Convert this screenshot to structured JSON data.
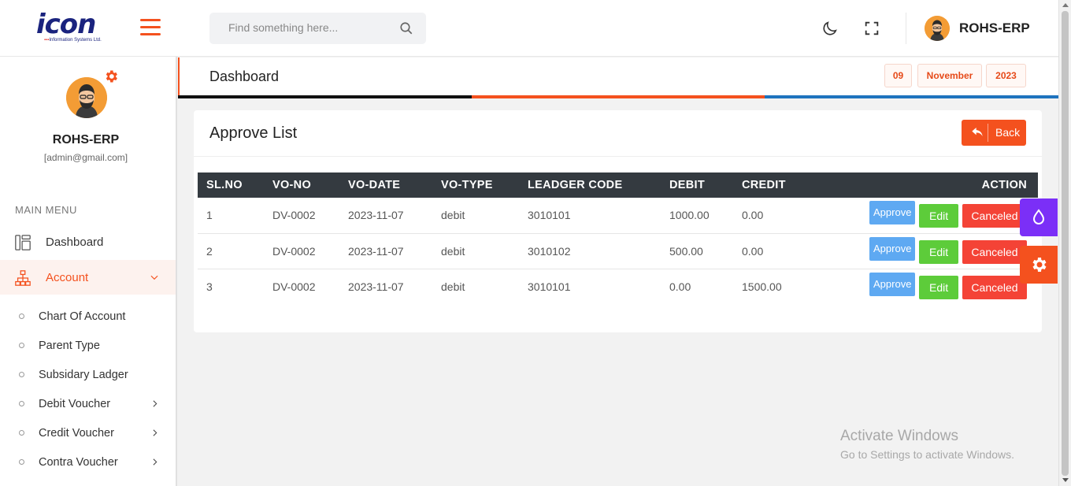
{
  "brand": {
    "logo_text": "icon",
    "logo_subtitle": "Information Systems Ltd."
  },
  "header": {
    "search_placeholder": "Find something here...",
    "username": "ROHS-ERP"
  },
  "sidebar": {
    "profile": {
      "name": "ROHS-ERP",
      "email": "[admin@gmail.com]"
    },
    "menu_heading": "MAIN MENU",
    "items": [
      {
        "label": "Dashboard"
      },
      {
        "label": "Account"
      }
    ],
    "account_sub_items": [
      {
        "label": "Chart Of Account"
      },
      {
        "label": "Parent Type"
      },
      {
        "label": "Subsidary Ladger"
      },
      {
        "label": "Debit Voucher"
      },
      {
        "label": "Credit Voucher"
      },
      {
        "label": "Contra Voucher"
      }
    ]
  },
  "page": {
    "title": "Dashboard",
    "date": {
      "day": "09",
      "month": "November",
      "year": "2023"
    },
    "accent_colors": [
      "#111111",
      "#f4511e",
      "#1e73be"
    ]
  },
  "card": {
    "title": "Approve List",
    "back_label": "Back",
    "columns": [
      "SL.NO",
      "VO-NO",
      "VO-DATE",
      "VO-TYPE",
      "LEADGER CODE",
      "DEBIT",
      "CREDIT",
      "ACTION"
    ],
    "rows": [
      {
        "sl": "1",
        "vo_no": "DV-0002",
        "vo_date": "2023-11-07",
        "vo_type": "debit",
        "code": "3010101",
        "debit": "1000.00",
        "credit": "0.00"
      },
      {
        "sl": "2",
        "vo_no": "DV-0002",
        "vo_date": "2023-11-07",
        "vo_type": "debit",
        "code": "3010102",
        "debit": "500.00",
        "credit": "0.00"
      },
      {
        "sl": "3",
        "vo_no": "DV-0002",
        "vo_date": "2023-11-07",
        "vo_type": "debit",
        "code": "3010101",
        "debit": "0.00",
        "credit": "1500.00"
      }
    ],
    "actions": {
      "approve": "Approve",
      "edit": "Edit",
      "cancel": "Canceled"
    }
  },
  "watermark": {
    "line1": "Activate Windows",
    "line2": "Go to Settings to activate Windows."
  },
  "colors": {
    "primary": "#f4511e",
    "approve": "#5ea9f2",
    "edit": "#5dcc3a",
    "cancel": "#f44336",
    "theme_widget": "#7b2ff7"
  }
}
